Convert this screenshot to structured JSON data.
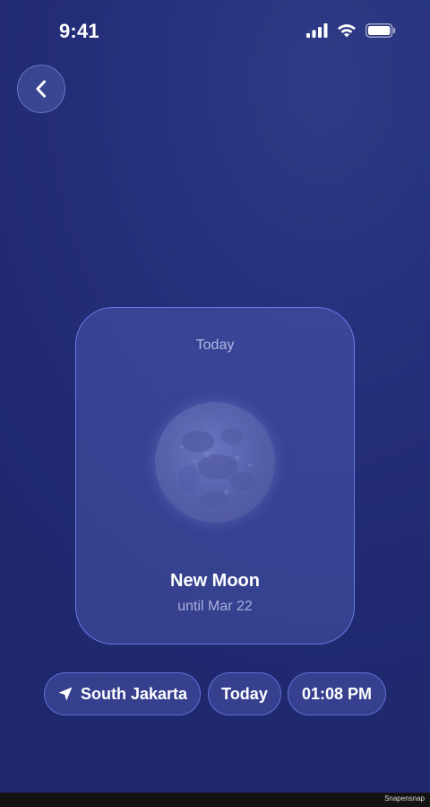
{
  "status_bar": {
    "time": "9:41",
    "icons": [
      "cellular-signal-icon",
      "wifi-icon",
      "battery-icon"
    ]
  },
  "nav": {
    "back_icon": "chevron-left-icon"
  },
  "card": {
    "label": "Today",
    "phase_name": "New Moon",
    "until_text": "until Mar 22"
  },
  "controls": {
    "location_icon": "location-arrow-icon",
    "location_label": "South Jakarta",
    "day_label": "Today",
    "time_label": "01:08 PM"
  },
  "watermark": "Snapensnap",
  "colors": {
    "background": "#232c74",
    "card_border": "#7a8cff",
    "moon": "#5862ad"
  }
}
